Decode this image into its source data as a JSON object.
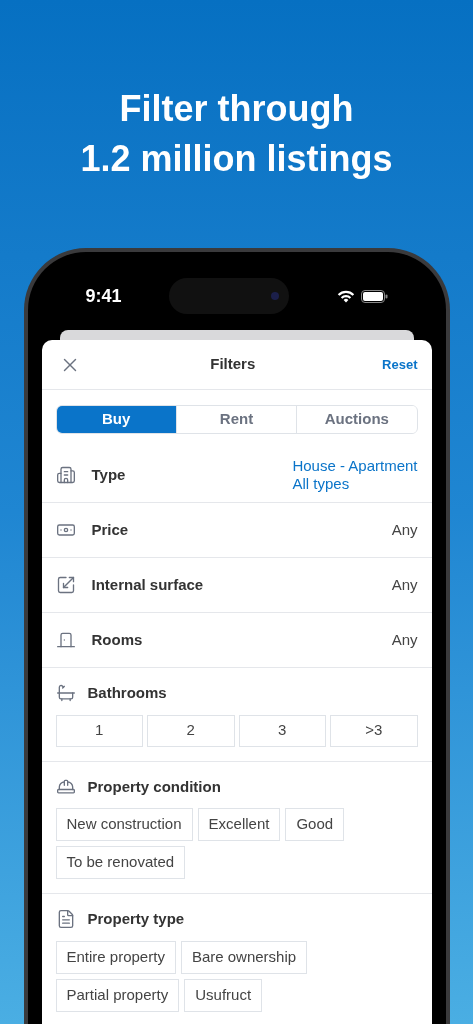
{
  "headline": [
    "Filter through",
    "1.2 million listings"
  ],
  "status_bar": {
    "time": "9:41"
  },
  "sheet": {
    "title": "Filters",
    "reset": "Reset",
    "tabs": [
      {
        "label": "Buy",
        "selected": true
      },
      {
        "label": "Rent",
        "selected": false
      },
      {
        "label": "Auctions",
        "selected": false
      }
    ],
    "rows": [
      {
        "kind": "link",
        "label": "Type",
        "values": [
          "House - Apartment",
          "All types"
        ]
      },
      {
        "kind": "plain",
        "label": "Price",
        "values": [
          "Any"
        ]
      },
      {
        "kind": "plain",
        "label": "Internal surface",
        "values": [
          "Any"
        ]
      },
      {
        "kind": "plain",
        "label": "Rooms",
        "values": [
          "Any"
        ]
      }
    ],
    "groups": [
      {
        "title": "Bathrooms",
        "kind": "grid",
        "options": [
          {
            "label": "1",
            "selected": false
          },
          {
            "label": "2",
            "selected": false
          },
          {
            "label": "3",
            "selected": false
          },
          {
            "label": ">3",
            "selected": false
          }
        ]
      },
      {
        "title": "Property condition",
        "kind": "chips",
        "options": [
          {
            "label": "New construction",
            "selected": false
          },
          {
            "label": "Excellent",
            "selected": false
          },
          {
            "label": "Good",
            "selected": false
          },
          {
            "label": "To be renovated",
            "selected": false
          }
        ]
      },
      {
        "title": "Property type",
        "kind": "chips",
        "options": [
          {
            "label": "Entire property",
            "selected": false
          },
          {
            "label": "Bare ownership",
            "selected": false
          },
          {
            "label": "Partial property",
            "selected": false
          },
          {
            "label": "Usufruct",
            "selected": false
          }
        ]
      }
    ]
  }
}
